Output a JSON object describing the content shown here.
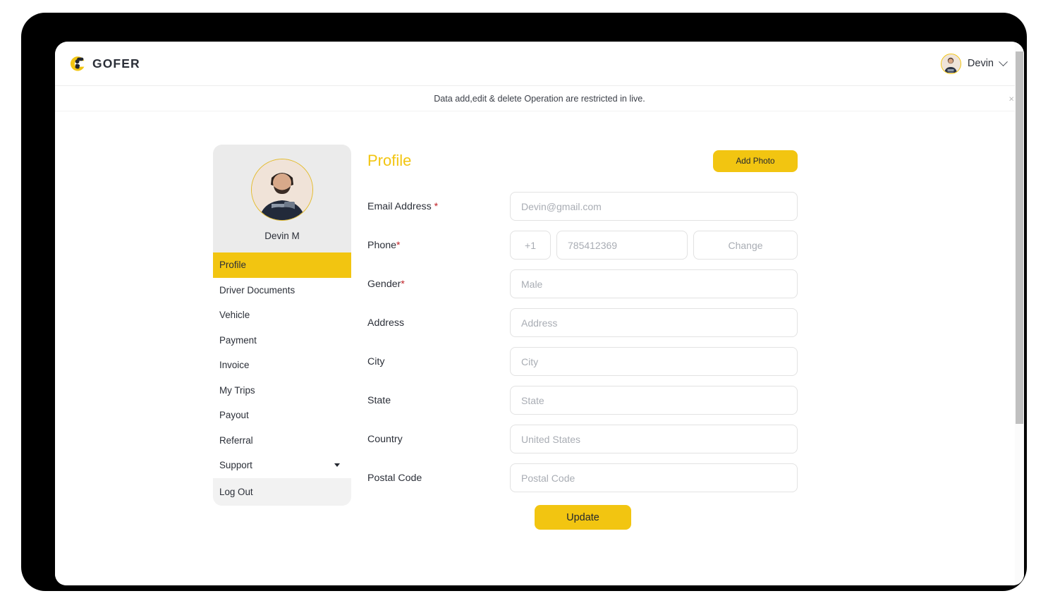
{
  "header": {
    "brand_name": "GOFER",
    "logo_icon": "gofer-logo-icon",
    "user_name": "Devin",
    "user_avatar_icon": "user-avatar-image",
    "chevron_icon": "chevron-down-icon"
  },
  "notice": {
    "text": "Data add,edit & delete Operation are restricted in live.",
    "close_icon": "close-icon",
    "close_label": "×"
  },
  "profile_card": {
    "avatar_icon": "profile-photo-image",
    "name": "Devin M",
    "menu": [
      {
        "label": "Profile",
        "active": true
      },
      {
        "label": "Driver Documents",
        "active": false
      },
      {
        "label": "Vehicle",
        "active": false
      },
      {
        "label": "Payment",
        "active": false
      },
      {
        "label": "Invoice",
        "active": false
      },
      {
        "label": "My Trips",
        "active": false
      },
      {
        "label": "Payout",
        "active": false
      },
      {
        "label": "Referral",
        "active": false
      },
      {
        "label": "Support",
        "active": false,
        "caret_icon": "caret-down-icon"
      },
      {
        "label": "Log Out",
        "active": false
      }
    ]
  },
  "form": {
    "title": "Profile",
    "add_photo_label": "Add Photo",
    "update_label": "Update",
    "required_mark": "*",
    "fields": {
      "email": {
        "label": "Email Address",
        "placeholder": "Devin@gmail.com",
        "value": ""
      },
      "phone": {
        "label": "Phone",
        "country_code": "+1",
        "placeholder": "785412369",
        "value": "",
        "change_label": "Change"
      },
      "gender": {
        "label": "Gender",
        "placeholder": "Male",
        "value": ""
      },
      "address": {
        "label": "Address",
        "placeholder": "Address",
        "value": ""
      },
      "city": {
        "label": "City",
        "placeholder": "City",
        "value": ""
      },
      "state": {
        "label": "State",
        "placeholder": "State",
        "value": ""
      },
      "country": {
        "label": "Country",
        "placeholder": "United States",
        "value": ""
      },
      "postal": {
        "label": "Postal Code",
        "placeholder": "Postal Code",
        "value": ""
      }
    }
  },
  "colors": {
    "brand_yellow": "#f2c511",
    "required_red": "#c02026",
    "card_gray": "#ebebeb",
    "text_dark": "#2b2f38",
    "placeholder_gray": "#a9adb4"
  }
}
